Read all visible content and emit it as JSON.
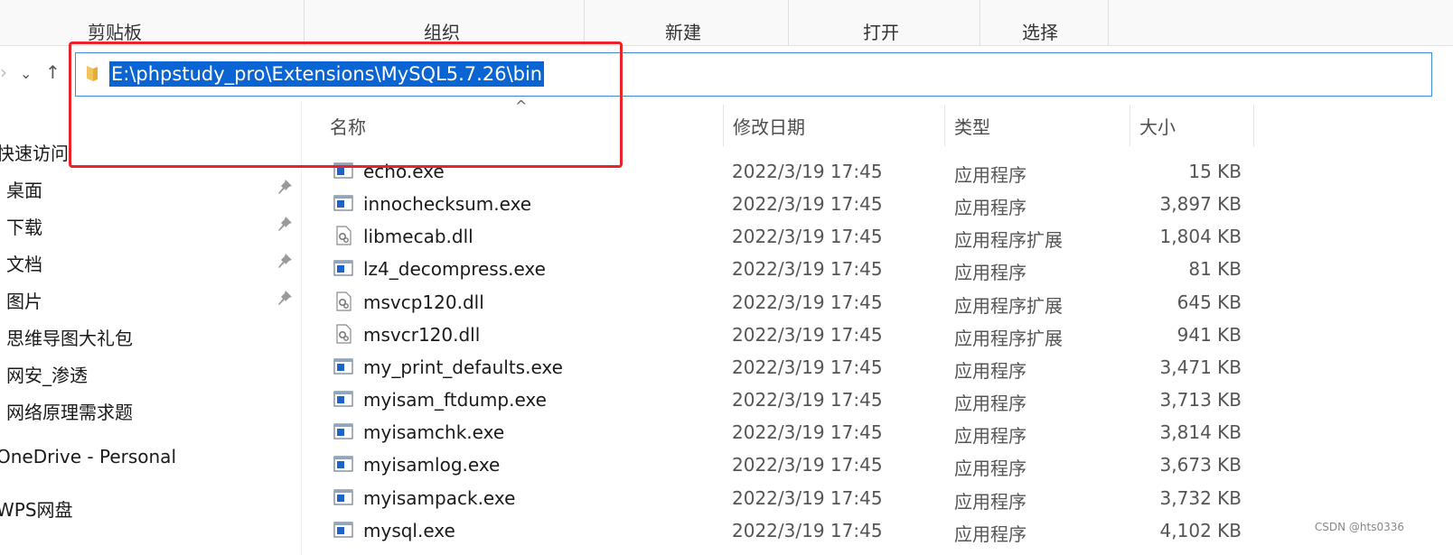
{
  "ribbon": {
    "groups": [
      {
        "label": "剪贴板"
      },
      {
        "label": "组织"
      },
      {
        "label": "新建"
      },
      {
        "label": "打开"
      },
      {
        "label": "选择"
      }
    ]
  },
  "nav": {
    "address": "E:\\phpstudy_pro\\Extensions\\MySQL5.7.26\\bin"
  },
  "sidebar": {
    "quick_access": "快速访问",
    "items": [
      {
        "label": "桌面",
        "pinned": true
      },
      {
        "label": "下载",
        "pinned": true
      },
      {
        "label": "文档",
        "pinned": true
      },
      {
        "label": "图片",
        "pinned": true
      },
      {
        "label": "思维导图大礼包",
        "pinned": false
      },
      {
        "label": "网安_渗透",
        "pinned": false
      },
      {
        "label": "网络原理需求题",
        "pinned": false
      }
    ],
    "onedrive": "OneDrive - Personal",
    "wps": "WPS网盘"
  },
  "columns": {
    "name": "名称",
    "date": "修改日期",
    "type": "类型",
    "size": "大小"
  },
  "files": [
    {
      "name": "echo.exe",
      "date": "2022/3/19 17:45",
      "type": "应用程序",
      "size": "15 KB",
      "icon": "exe-icon"
    },
    {
      "name": "innochecksum.exe",
      "date": "2022/3/19 17:45",
      "type": "应用程序",
      "size": "3,897 KB",
      "icon": "exe-icon"
    },
    {
      "name": "libmecab.dll",
      "date": "2022/3/19 17:45",
      "type": "应用程序扩展",
      "size": "1,804 KB",
      "icon": "dll-icon"
    },
    {
      "name": "lz4_decompress.exe",
      "date": "2022/3/19 17:45",
      "type": "应用程序",
      "size": "81 KB",
      "icon": "exe-icon"
    },
    {
      "name": "msvcp120.dll",
      "date": "2022/3/19 17:45",
      "type": "应用程序扩展",
      "size": "645 KB",
      "icon": "dll-icon"
    },
    {
      "name": "msvcr120.dll",
      "date": "2022/3/19 17:45",
      "type": "应用程序扩展",
      "size": "941 KB",
      "icon": "dll-icon"
    },
    {
      "name": "my_print_defaults.exe",
      "date": "2022/3/19 17:45",
      "type": "应用程序",
      "size": "3,471 KB",
      "icon": "exe-icon"
    },
    {
      "name": "myisam_ftdump.exe",
      "date": "2022/3/19 17:45",
      "type": "应用程序",
      "size": "3,713 KB",
      "icon": "exe-icon"
    },
    {
      "name": "myisamchk.exe",
      "date": "2022/3/19 17:45",
      "type": "应用程序",
      "size": "3,814 KB",
      "icon": "exe-icon"
    },
    {
      "name": "myisamlog.exe",
      "date": "2022/3/19 17:45",
      "type": "应用程序",
      "size": "3,673 KB",
      "icon": "exe-icon"
    },
    {
      "name": "myisampack.exe",
      "date": "2022/3/19 17:45",
      "type": "应用程序",
      "size": "3,732 KB",
      "icon": "exe-icon"
    },
    {
      "name": "mysql.exe",
      "date": "2022/3/19 17:45",
      "type": "应用程序",
      "size": "4,102 KB",
      "icon": "exe-icon"
    }
  ],
  "watermark": "CSDN @hts0336",
  "colors": {
    "selection": "#0a64d1",
    "highlight_border": "#e8232a",
    "address_border": "#3c8cd2"
  }
}
